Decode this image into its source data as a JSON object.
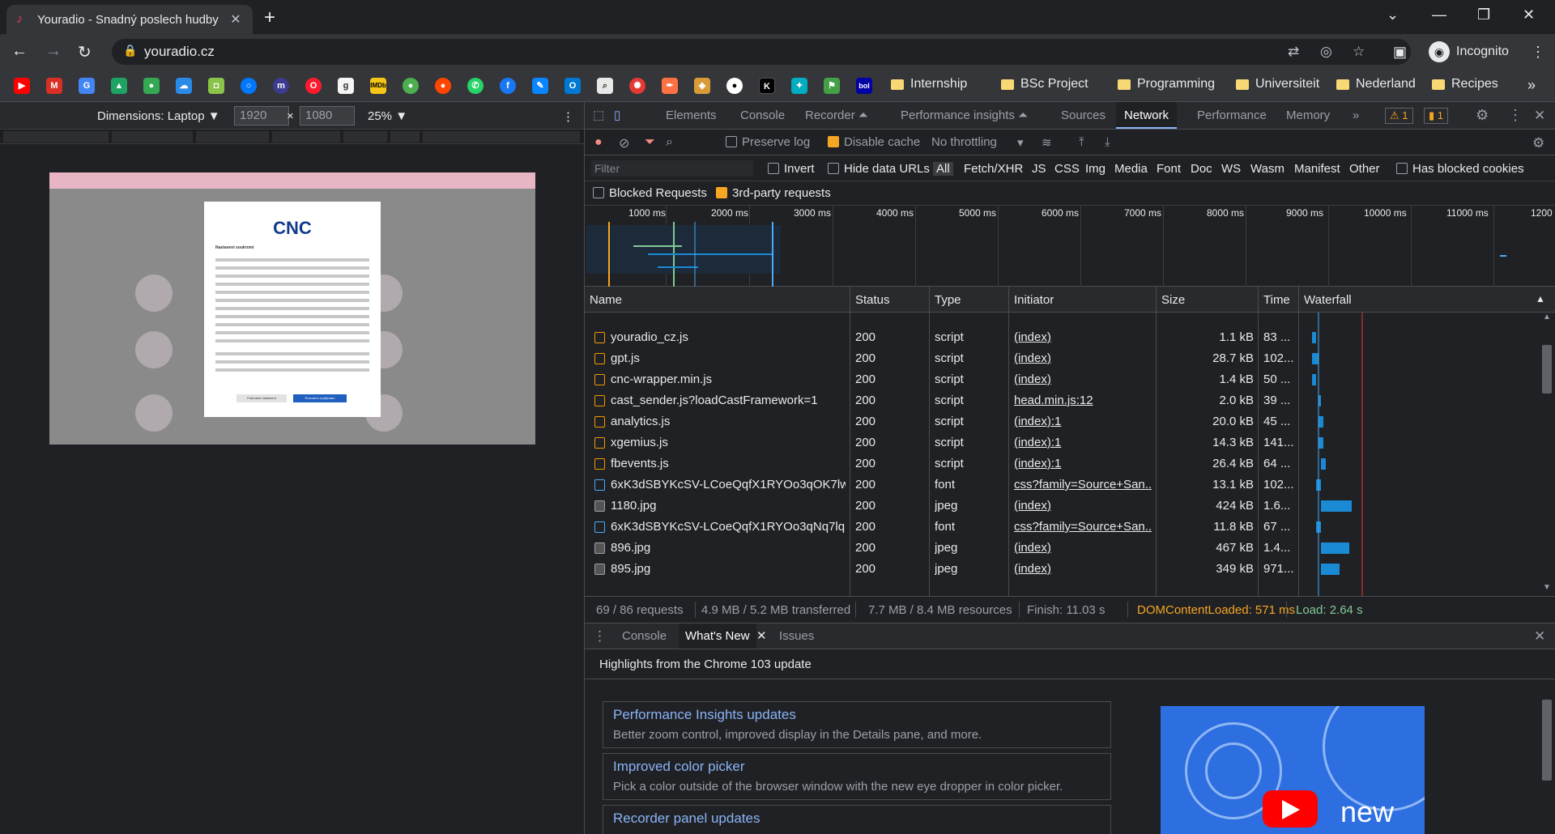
{
  "tab": {
    "title": "Youradio - Snadný poslech hudby",
    "close": "✕",
    "new_tab": "+"
  },
  "window_controls": {
    "dropdown": "⌄",
    "minimize": "—",
    "restore": "❐",
    "close": "✕"
  },
  "toolbar": {
    "back": "←",
    "forward": "→",
    "reload": "↻",
    "url": "youradio.cz",
    "lock": "🔒",
    "profile": "Incognito"
  },
  "bookmarks": {
    "icons": [
      "youtube-icon",
      "gmail-icon",
      "translate-icon",
      "drive-icon",
      "maps-icon",
      "cloud-icon",
      "android-icon",
      "circle-icon",
      "m-icon",
      "opera-icon",
      "g-icon",
      "imdb-icon",
      "colors-icon",
      "reddit-icon",
      "whatsapp-icon",
      "facebook-icon",
      "edit-icon",
      "outlook-icon",
      "search-icon",
      "gear-icon",
      "pen-icon",
      "owl-icon",
      "github-icon",
      "k-icon",
      "bird-icon",
      "flag-icon",
      "bol-icon"
    ],
    "folders": [
      "Internship",
      "BSc Project",
      "Programming",
      "Universiteit",
      "Nederland",
      "Recipes"
    ],
    "more": "»"
  },
  "device": {
    "dimensions_label": "Dimensions: Laptop ▼",
    "width": "1920",
    "times": "×",
    "height": "1080",
    "zoom": "25% ▼",
    "menu": "⋮"
  },
  "emulated_page": {
    "brand": "CNC",
    "modal_title": "Nastavení soukromí",
    "reject": "Podrobné nastavení",
    "accept": "Rozumím a přijímám"
  },
  "devtools": {
    "tabs": [
      "Elements",
      "Console",
      "Recorder ⏶",
      "Performance insights ⏶",
      "Sources",
      "Network",
      "Performance",
      "Memory",
      "»"
    ],
    "active_tab": "Network",
    "warnings": "⚠ 1",
    "errors": "▮ 1",
    "netbar": {
      "preserve_log": "Preserve log",
      "disable_cache": "Disable cache",
      "throttling": "No throttling"
    },
    "filter": {
      "placeholder": "Filter",
      "invert": "Invert",
      "hide_data_urls": "Hide data URLs",
      "types": [
        "All",
        "Fetch/XHR",
        "JS",
        "CSS",
        "Img",
        "Media",
        "Font",
        "Doc",
        "WS",
        "Wasm",
        "Manifest",
        "Other"
      ],
      "has_blocked_cookies": "Has blocked cookies",
      "blocked_requests": "Blocked Requests",
      "third_party": "3rd-party requests"
    },
    "overview_ticks": [
      "1000 ms",
      "2000 ms",
      "3000 ms",
      "4000 ms",
      "5000 ms",
      "6000 ms",
      "7000 ms",
      "8000 ms",
      "9000 ms",
      "10000 ms",
      "11000 ms",
      "1200"
    ],
    "columns": [
      "Name",
      "Status",
      "Type",
      "Initiator",
      "Size",
      "Time",
      "Waterfall"
    ],
    "rows": [
      {
        "name": "youradio_cz.js",
        "status": "200",
        "type": "script",
        "initiator": "(index)",
        "size": "1.1 kB",
        "time": "83 ...",
        "kind": "script",
        "wf_start": 0.04,
        "wf_len": 0.02
      },
      {
        "name": "gpt.js",
        "status": "200",
        "type": "script",
        "initiator": "(index)",
        "size": "28.7 kB",
        "time": "102...",
        "kind": "script",
        "wf_start": 0.04,
        "wf_len": 0.03
      },
      {
        "name": "cnc-wrapper.min.js",
        "status": "200",
        "type": "script",
        "initiator": "(index)",
        "size": "1.4 kB",
        "time": "50 ...",
        "kind": "script",
        "wf_start": 0.04,
        "wf_len": 0.02
      },
      {
        "name": "cast_sender.js?loadCastFramework=1",
        "status": "200",
        "type": "script",
        "initiator": "head.min.js:12",
        "size": "2.0 kB",
        "time": "39 ...",
        "kind": "script",
        "wf_start": 0.07,
        "wf_len": 0.01
      },
      {
        "name": "analytics.js",
        "status": "200",
        "type": "script",
        "initiator": "(index):1",
        "size": "20.0 kB",
        "time": "45 ...",
        "kind": "script",
        "wf_start": 0.07,
        "wf_len": 0.02
      },
      {
        "name": "xgemius.js",
        "status": "200",
        "type": "script",
        "initiator": "(index):1",
        "size": "14.3 kB",
        "time": "141...",
        "kind": "script",
        "wf_start": 0.07,
        "wf_len": 0.02
      },
      {
        "name": "fbevents.js",
        "status": "200",
        "type": "script",
        "initiator": "(index):1",
        "size": "26.4 kB",
        "time": "64 ...",
        "kind": "script",
        "wf_start": 0.08,
        "wf_len": 0.02
      },
      {
        "name": "6xK3dSBYKcSV-LCoeQqfX1RYOo3qOK7lw...",
        "status": "200",
        "type": "font",
        "initiator": "css?family=Source+San...",
        "size": "13.1 kB",
        "time": "102...",
        "kind": "font",
        "wf_start": 0.06,
        "wf_len": 0.02
      },
      {
        "name": "1180.jpg",
        "status": "200",
        "type": "jpeg",
        "initiator": "(index)",
        "size": "424 kB",
        "time": "1.6...",
        "kind": "img",
        "wf_start": 0.08,
        "wf_len": 0.13
      },
      {
        "name": "6xK3dSBYKcSV-LCoeQqfX1RYOo3qNq7lq...",
        "status": "200",
        "type": "font",
        "initiator": "css?family=Source+San...",
        "size": "11.8 kB",
        "time": "67 ...",
        "kind": "font",
        "wf_start": 0.06,
        "wf_len": 0.02
      },
      {
        "name": "896.jpg",
        "status": "200",
        "type": "jpeg",
        "initiator": "(index)",
        "size": "467 kB",
        "time": "1.4...",
        "kind": "img",
        "wf_start": 0.08,
        "wf_len": 0.12
      },
      {
        "name": "895.jpg",
        "status": "200",
        "type": "jpeg",
        "initiator": "(index)",
        "size": "349 kB",
        "time": "971...",
        "kind": "img",
        "wf_start": 0.08,
        "wf_len": 0.08
      }
    ],
    "summary": {
      "requests": "69 / 86 requests",
      "transferred": "4.9 MB / 5.2 MB transferred",
      "resources": "7.7 MB / 8.4 MB resources",
      "finish": "Finish: 11.03 s",
      "dcl": "DOMContentLoaded: 571 ms",
      "load": "Load: 2.64 s"
    },
    "drawer": {
      "tabs": [
        "Console",
        "What's New",
        "Issues"
      ],
      "close": "✕",
      "header": "Highlights from the Chrome 103 update",
      "cards": [
        {
          "title": "Performance Insights updates",
          "desc": "Better zoom control, improved display in the Details pane, and more."
        },
        {
          "title": "Improved color picker",
          "desc": "Pick a color outside of the browser window with the new eye dropper in color picker."
        },
        {
          "title": "Recorder panel updates",
          "desc": ""
        }
      ],
      "video_text": "new"
    }
  },
  "colors": {
    "accent": "#8ab4f8",
    "dcl": "#f5a623",
    "load": "#81c995",
    "waterfall_bar": "#1a8ad4"
  }
}
